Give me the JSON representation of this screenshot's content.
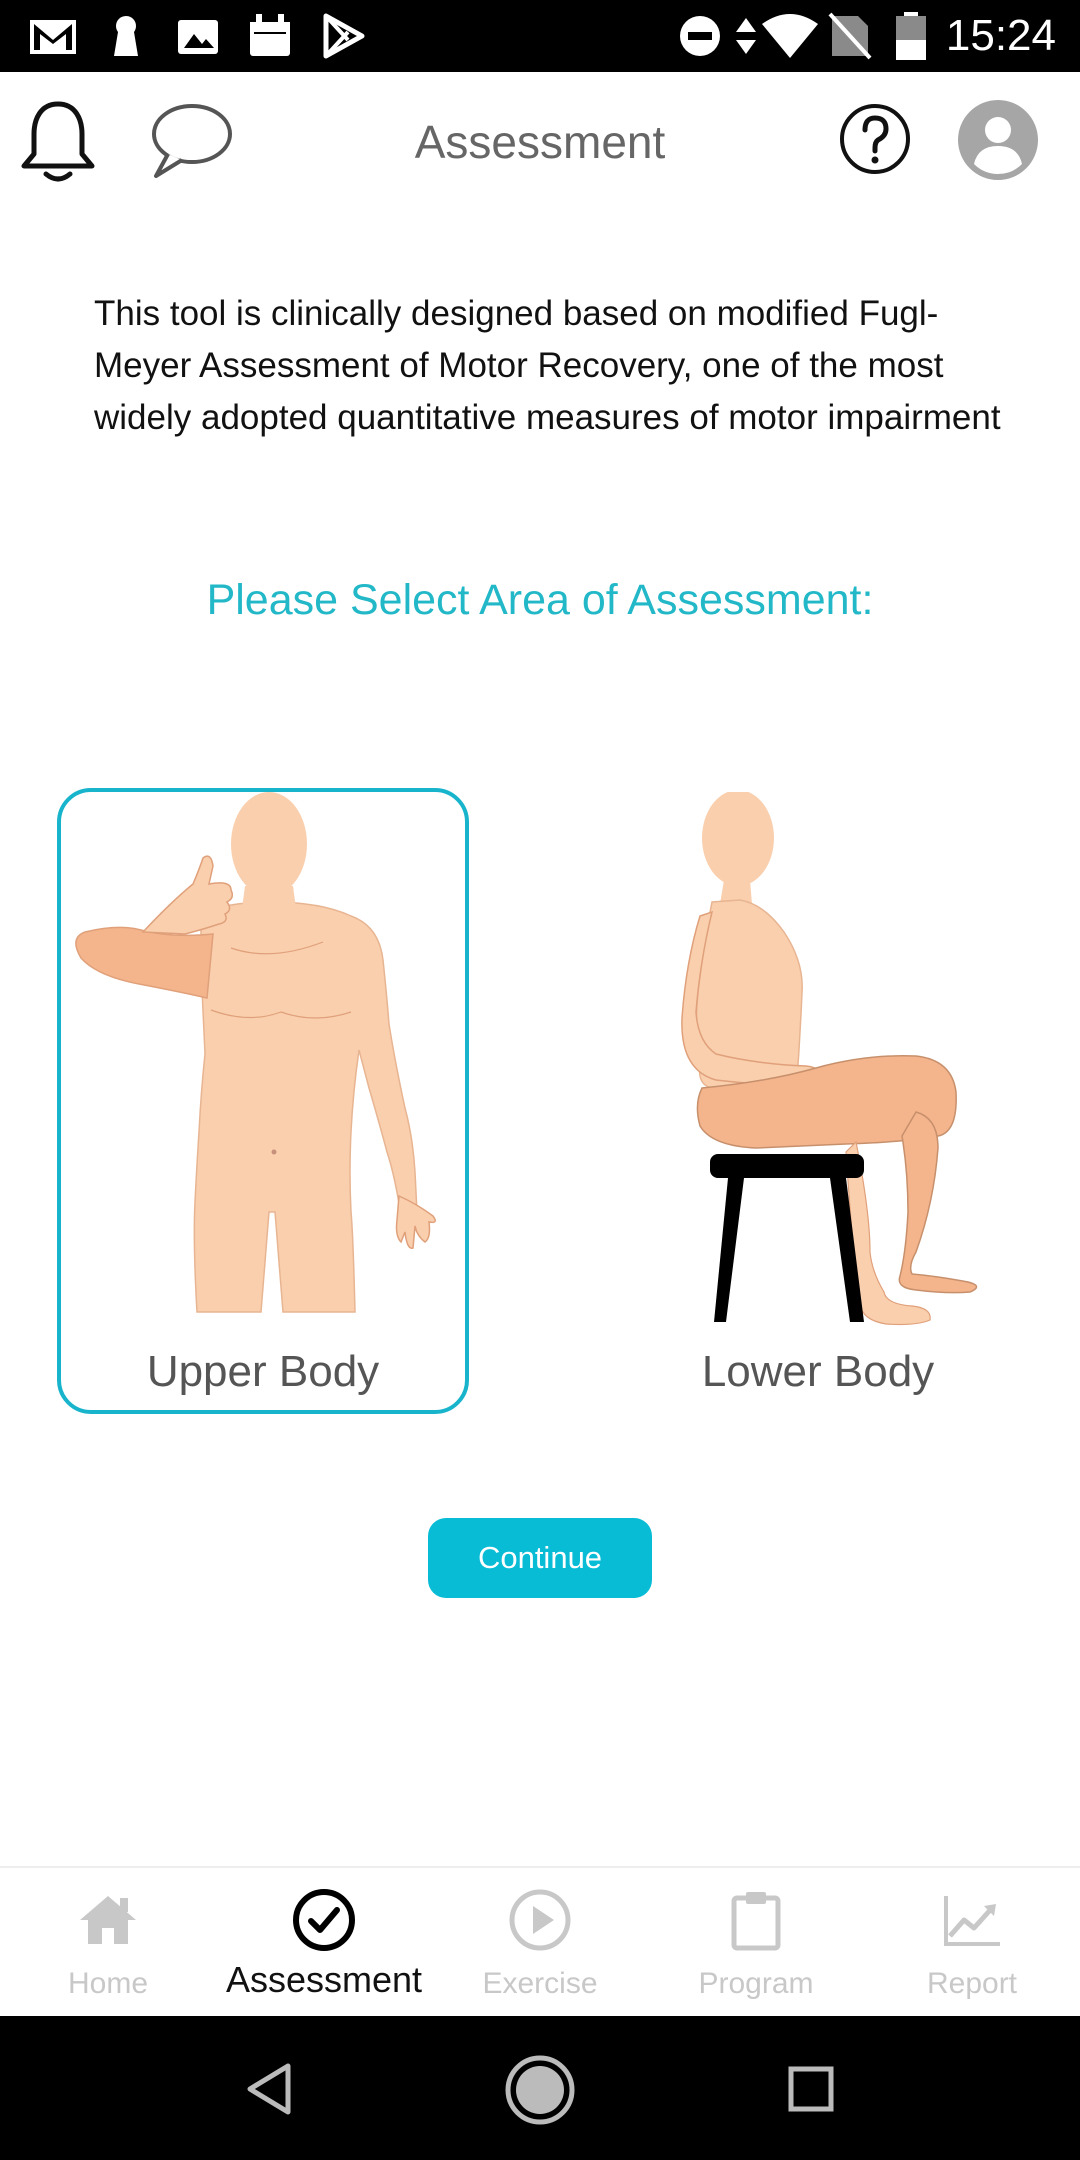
{
  "status_bar": {
    "time": "15:24",
    "left_icons": [
      "gmail-icon",
      "keyhole-icon",
      "image-icon",
      "calendar-icon",
      "play-store-icon"
    ],
    "right_icons": [
      "do-not-disturb-icon",
      "data-arrows-icon",
      "wifi-icon",
      "no-sim-icon",
      "battery-icon"
    ]
  },
  "header": {
    "title": "Assessment",
    "icons": [
      "bell-icon",
      "chat-icon",
      "help-icon",
      "profile-icon"
    ]
  },
  "intro_text": "This tool is clinically designed based on modified Fugl-Meyer Assessment of Motor Recovery, one of the most widely adopted quantitative measures of motor impairment",
  "prompt": "Please Select Area of Assessment:",
  "options": [
    {
      "label": "Upper Body",
      "selected": true
    },
    {
      "label": "Lower Body",
      "selected": false
    }
  ],
  "continue_label": "Continue",
  "bottom_nav": [
    {
      "label": "Home",
      "icon": "home-icon",
      "active": false
    },
    {
      "label": "Assessment",
      "icon": "check-circle-icon",
      "active": true
    },
    {
      "label": "Exercise",
      "icon": "play-circle-icon",
      "active": false
    },
    {
      "label": "Program",
      "icon": "clipboard-icon",
      "active": false
    },
    {
      "label": "Report",
      "icon": "trend-chart-icon",
      "active": false
    }
  ],
  "system_nav": [
    "back-icon",
    "home-circle-icon",
    "recents-icon"
  ],
  "colors": {
    "accent": "#18b4cc",
    "prompt": "#22b8c8",
    "button": "#08bcd6",
    "skin": "#f9cfae",
    "skin_dark": "#f4b48c",
    "nav_inactive": "#c8c8c8"
  }
}
